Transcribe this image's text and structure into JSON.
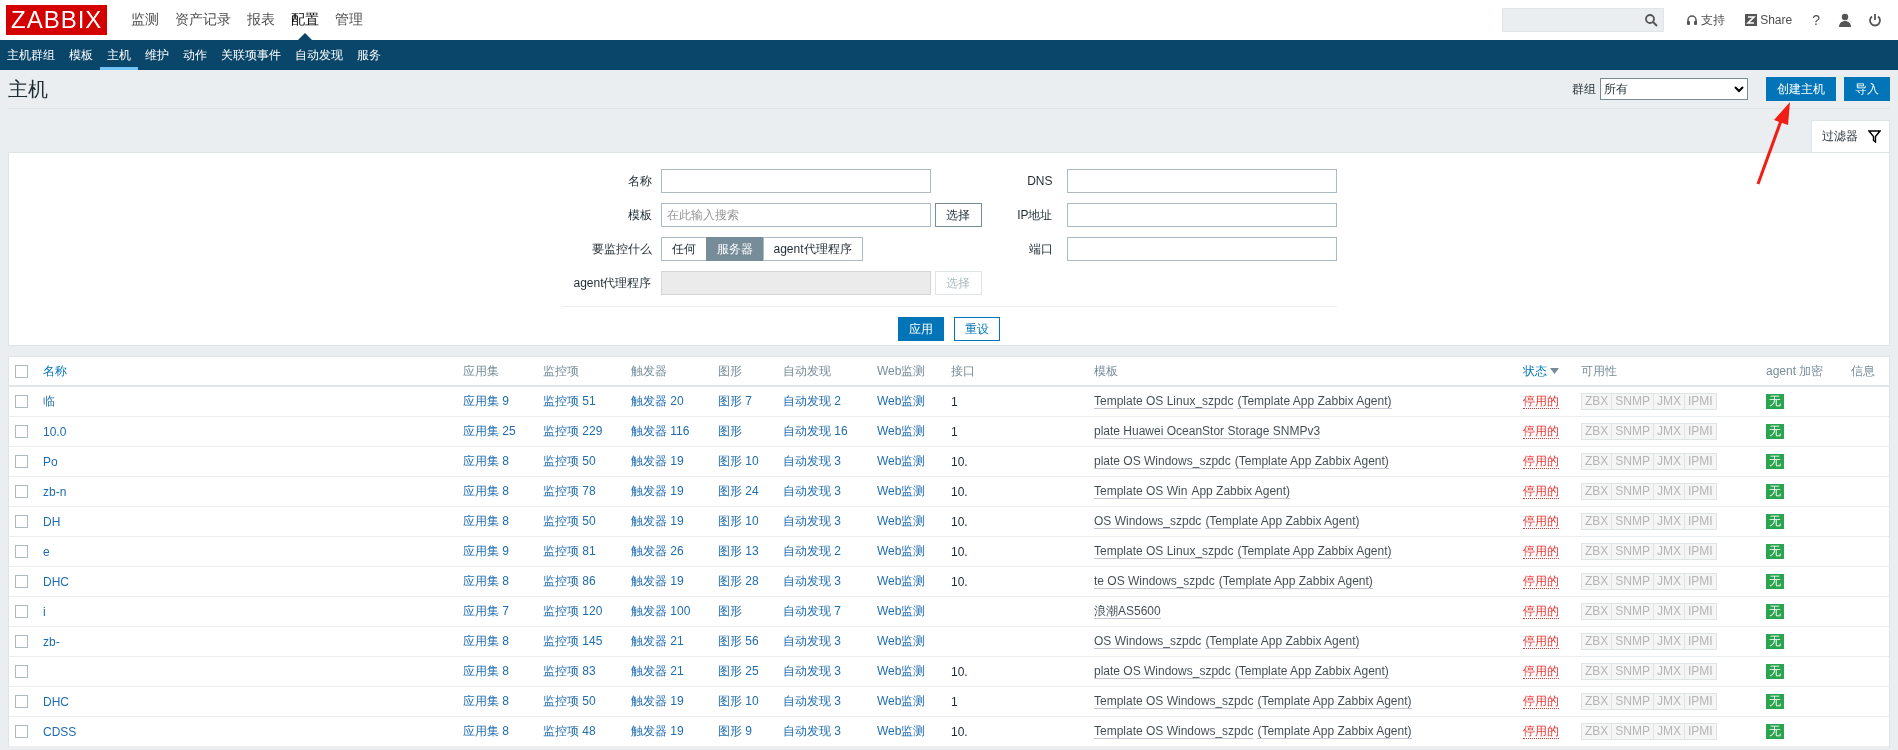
{
  "logo": "ZABBIX",
  "top_menu": [
    {
      "label": "监测",
      "selected": false
    },
    {
      "label": "资产记录",
      "selected": false
    },
    {
      "label": "报表",
      "selected": false
    },
    {
      "label": "配置",
      "selected": true
    },
    {
      "label": "管理",
      "selected": false
    }
  ],
  "header_links": [
    {
      "kind": "support",
      "label": "支持"
    },
    {
      "kind": "share",
      "label": "Share"
    },
    {
      "kind": "help",
      "label": "?"
    }
  ],
  "sub_menu": [
    {
      "label": "主机群组",
      "selected": false
    },
    {
      "label": "模板",
      "selected": false
    },
    {
      "label": "主机",
      "selected": true
    },
    {
      "label": "维护",
      "selected": false
    },
    {
      "label": "动作",
      "selected": false
    },
    {
      "label": "关联项事件",
      "selected": false
    },
    {
      "label": "自动发现",
      "selected": false
    },
    {
      "label": "服务",
      "selected": false
    }
  ],
  "page_title": "主机",
  "group_filter": {
    "label": "群组",
    "value": "所有"
  },
  "buttons": [
    "创建主机",
    "导入"
  ],
  "filter_tab": "过滤器",
  "filter": {
    "left": [
      {
        "kind": "text",
        "label": "名称"
      },
      {
        "kind": "text-select",
        "label": "模板",
        "placeholder": "在此输入搜索",
        "button": "选择",
        "disabled": false
      },
      {
        "kind": "radio",
        "label": "要监控什么",
        "options": [
          {
            "label": "任何",
            "selected": false
          },
          {
            "label": "服务器",
            "selected": true
          },
          {
            "label": "agent代理程序",
            "selected": false
          }
        ]
      },
      {
        "kind": "text-select",
        "label": "agent代理程序",
        "button": "选择",
        "disabled": true
      }
    ],
    "right": [
      {
        "label": "DNS"
      },
      {
        "label": "IP地址"
      },
      {
        "label": "端口"
      }
    ],
    "apply": "应用",
    "reset": "重设"
  },
  "table": {
    "all_checked": false,
    "columns": [
      {
        "label": "名称",
        "sortable": true,
        "sorted": false
      },
      {
        "label": "应用集",
        "sortable": false,
        "sorted": false
      },
      {
        "label": "监控项",
        "sortable": false,
        "sorted": false
      },
      {
        "label": "触发器",
        "sortable": false,
        "sorted": false
      },
      {
        "label": "图形",
        "sortable": false,
        "sorted": false
      },
      {
        "label": "自动发现",
        "sortable": false,
        "sorted": false
      },
      {
        "label": "Web监测",
        "sortable": false,
        "sorted": false
      },
      {
        "label": "接口",
        "sortable": false,
        "sorted": false
      },
      {
        "label": "模板",
        "sortable": false,
        "sorted": false
      },
      {
        "label": "状态",
        "sortable": true,
        "sorted": true
      },
      {
        "label": "可用性",
        "sortable": false,
        "sorted": false
      },
      {
        "label": "agent 加密",
        "sortable": false,
        "sorted": false
      },
      {
        "label": "信息",
        "sortable": false,
        "sorted": false
      }
    ],
    "rows": [
      {
        "checked": false,
        "name": "临",
        "applications": "应用集 9",
        "items": "监控项 51",
        "triggers": "触发器 20",
        "graphs": "图形 7",
        "discovery": "自动发现 2",
        "web": "Web监测",
        "interface": "1",
        "templates": [
          "Template OS Linux_szpdc",
          "(Template App Zabbix Agent)"
        ],
        "status": "停用的",
        "availability": [
          "ZBX",
          "SNMP",
          "JMX",
          "IPMI"
        ],
        "encryption": "无"
      },
      {
        "checked": false,
        "name": "10.0",
        "applications": "应用集 25",
        "items": "监控项 229",
        "triggers": "触发器 116",
        "graphs": "图形",
        "discovery": "自动发现 16",
        "web": "Web监测",
        "interface": "1",
        "templates": [
          "plate Huawei OceanStor Storage SNMPv3"
        ],
        "status": "停用的",
        "availability": [
          "ZBX",
          "SNMP",
          "JMX",
          "IPMI"
        ],
        "encryption": "无"
      },
      {
        "checked": false,
        "name": "Po",
        "applications": "应用集 8",
        "items": "监控项 50",
        "triggers": "触发器 19",
        "graphs": "图形 10",
        "discovery": "自动发现 3",
        "web": "Web监测",
        "interface": "10.",
        "templates": [
          "plate OS Windows_szpdc",
          "(Template App Zabbix Agent)"
        ],
        "status": "停用的",
        "availability": [
          "ZBX",
          "SNMP",
          "JMX",
          "IPMI"
        ],
        "encryption": "无"
      },
      {
        "checked": false,
        "name": "zb-n",
        "applications": "应用集 8",
        "items": "监控项 78",
        "triggers": "触发器 19",
        "graphs": "图形 24",
        "discovery": "自动发现 3",
        "web": "Web监测",
        "interface": "10.",
        "templates": [
          "Template OS Win",
          "App Zabbix Agent)"
        ],
        "status": "停用的",
        "availability": [
          "ZBX",
          "SNMP",
          "JMX",
          "IPMI"
        ],
        "encryption": "无"
      },
      {
        "checked": false,
        "name": "DH",
        "applications": "应用集 8",
        "items": "监控项 50",
        "triggers": "触发器 19",
        "graphs": "图形 10",
        "discovery": "自动发现 3",
        "web": "Web监测",
        "interface": "10.",
        "templates": [
          "OS Windows_szpdc",
          "(Template App Zabbix Agent)"
        ],
        "status": "停用的",
        "availability": [
          "ZBX",
          "SNMP",
          "JMX",
          "IPMI"
        ],
        "encryption": "无"
      },
      {
        "checked": false,
        "name": "e",
        "applications": "应用集 9",
        "items": "监控项 81",
        "triggers": "触发器 26",
        "graphs": "图形 13",
        "discovery": "自动发现 2",
        "web": "Web监测",
        "interface": "10.",
        "templates": [
          "Template OS Linux_szpdc",
          "(Template App Zabbix Agent)"
        ],
        "status": "停用的",
        "availability": [
          "ZBX",
          "SNMP",
          "JMX",
          "IPMI"
        ],
        "encryption": "无"
      },
      {
        "checked": false,
        "name": "DHC",
        "applications": "应用集 8",
        "items": "监控项 86",
        "triggers": "触发器 19",
        "graphs": "图形 28",
        "discovery": "自动发现 3",
        "web": "Web监测",
        "interface": "10.",
        "templates": [
          "te OS Windows_szpdc",
          "(Template App Zabbix Agent)"
        ],
        "status": "停用的",
        "availability": [
          "ZBX",
          "SNMP",
          "JMX",
          "IPMI"
        ],
        "encryption": "无"
      },
      {
        "checked": false,
        "name": "i",
        "applications": "应用集 7",
        "items": "监控项 120",
        "triggers": "触发器 100",
        "graphs": "图形",
        "discovery": "自动发现 7",
        "web": "Web监测",
        "templates": [
          "浪潮AS5600"
        ],
        "status": "停用的",
        "availability": [
          "ZBX",
          "SNMP",
          "JMX",
          "IPMI"
        ],
        "encryption": "无"
      },
      {
        "checked": false,
        "name": "zb-",
        "applications": "应用集 8",
        "items": "监控项 145",
        "triggers": "触发器 21",
        "graphs": "图形 56",
        "discovery": "自动发现 3",
        "web": "Web监测",
        "templates": [
          "OS Windows_szpdc",
          "(Template App Zabbix Agent)"
        ],
        "status": "停用的",
        "availability": [
          "ZBX",
          "SNMP",
          "JMX",
          "IPMI"
        ],
        "encryption": "无"
      },
      {
        "checked": false,
        "applications": "应用集 8",
        "items": "监控项 83",
        "triggers": "触发器 21",
        "graphs": "图形 25",
        "discovery": "自动发现 3",
        "web": "Web监测",
        "interface": "10.",
        "templates": [
          "plate OS Windows_szpdc",
          "(Template App Zabbix Agent)"
        ],
        "status": "停用的",
        "availability": [
          "ZBX",
          "SNMP",
          "JMX",
          "IPMI"
        ],
        "encryption": "无"
      },
      {
        "checked": false,
        "name": "DHC",
        "applications": "应用集 8",
        "items": "监控项 50",
        "triggers": "触发器 19",
        "graphs": "图形 10",
        "discovery": "自动发现 3",
        "web": "Web监测",
        "interface": "1",
        "templates": [
          "Template OS Windows_szpdc",
          "(Template App Zabbix Agent)"
        ],
        "status": "停用的",
        "availability": [
          "ZBX",
          "SNMP",
          "JMX",
          "IPMI"
        ],
        "encryption": "无"
      },
      {
        "checked": false,
        "name": "CDSS",
        "applications": "应用集 8",
        "items": "监控项 48",
        "triggers": "触发器 19",
        "graphs": "图形 9",
        "discovery": "自动发现 3",
        "web": "Web监测",
        "interface": "10.",
        "templates": [
          "Template OS Windows_szpdc",
          "(Template App Zabbix Agent)"
        ],
        "status": "停用的",
        "availability": [
          "ZBX",
          "SNMP",
          "JMX",
          "IPMI"
        ],
        "encryption": "无"
      }
    ]
  }
}
